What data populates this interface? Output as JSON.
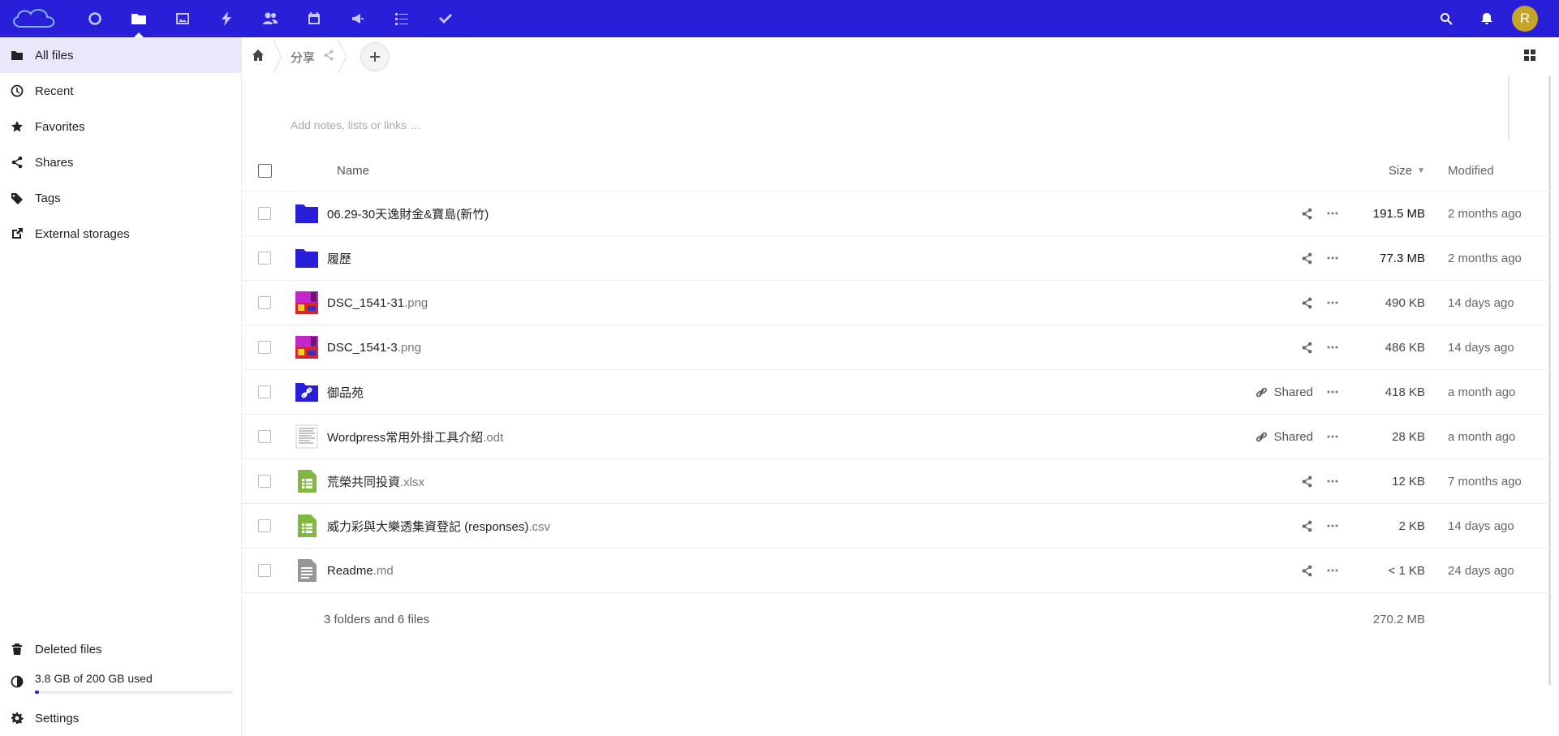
{
  "header": {
    "apps": [
      {
        "name": "dashboard-icon"
      },
      {
        "name": "files-icon"
      },
      {
        "name": "photos-icon"
      },
      {
        "name": "activity-icon"
      },
      {
        "name": "contacts-icon"
      },
      {
        "name": "calendar-icon"
      },
      {
        "name": "announcements-icon"
      },
      {
        "name": "deck-icon"
      },
      {
        "name": "tasks-icon"
      }
    ],
    "avatar_letter": "R",
    "accent_color": "#2a1fd9"
  },
  "sidebar": {
    "items": [
      {
        "label": "All files",
        "icon": "folder-icon"
      },
      {
        "label": "Recent",
        "icon": "clock-icon"
      },
      {
        "label": "Favorites",
        "icon": "star-icon"
      },
      {
        "label": "Shares",
        "icon": "share-icon"
      },
      {
        "label": "Tags",
        "icon": "tag-icon"
      },
      {
        "label": "External storages",
        "icon": "external-link-icon"
      }
    ],
    "deleted_label": "Deleted files",
    "quota_text": "3.8 GB of 200 GB used",
    "quota_fraction": 0.019,
    "settings_label": "Settings"
  },
  "breadcrumb": {
    "current": "分享"
  },
  "notes_placeholder": "Add notes, lists or links …",
  "table": {
    "col_name": "Name",
    "col_size": "Size",
    "col_modified": "Modified",
    "rows": [
      {
        "name": "06.29-30天逸財金&寶島(新竹)",
        "ext": "",
        "type": "folder",
        "share": "",
        "size": "191.5 MB",
        "modified": "2 months ago"
      },
      {
        "name": "履歷",
        "ext": "",
        "type": "folder",
        "share": "",
        "size": "77.3 MB",
        "modified": "2 months ago"
      },
      {
        "name": "DSC_1541-31",
        "ext": ".png",
        "type": "image",
        "share": "",
        "size": "490 KB",
        "modified": "14 days ago"
      },
      {
        "name": "DSC_1541-3",
        "ext": ".png",
        "type": "image",
        "share": "",
        "size": "486 KB",
        "modified": "14 days ago"
      },
      {
        "name": "御品苑",
        "ext": "",
        "type": "folder-link",
        "share": "Shared",
        "size": "418 KB",
        "modified": "a month ago"
      },
      {
        "name": "Wordpress常用外掛工具介紹",
        "ext": ".odt",
        "type": "document",
        "share": "Shared",
        "size": "28 KB",
        "modified": "a month ago"
      },
      {
        "name": "荒榮共同投資",
        "ext": ".xlsx",
        "type": "spreadsheet",
        "share": "",
        "size": "12 KB",
        "modified": "7 months ago"
      },
      {
        "name": "威力彩與大樂透集資登記 (responses)",
        "ext": ".csv",
        "type": "spreadsheet",
        "share": "",
        "size": "2 KB",
        "modified": "14 days ago"
      },
      {
        "name": "Readme",
        "ext": ".md",
        "type": "text",
        "share": "",
        "size": "< 1 KB",
        "modified": "24 days ago"
      }
    ],
    "summary_count": "3 folders and 6 files",
    "summary_total": "270.2 MB"
  }
}
